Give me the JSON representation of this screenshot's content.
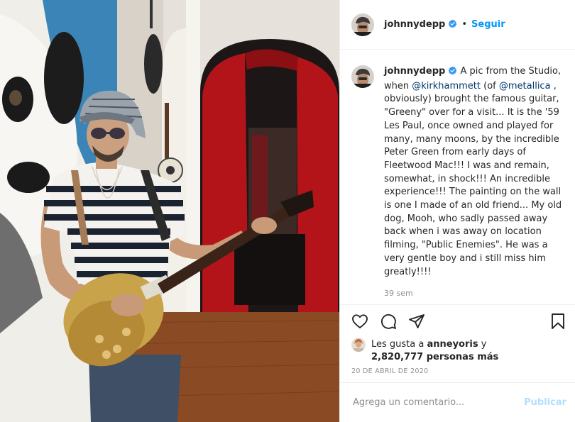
{
  "post": {
    "username": "johnnydepp",
    "follow_label": "Seguir",
    "dot": "•",
    "caption_parts": {
      "p1": "A pic from the Studio, when ",
      "m1": "@kirkhammett",
      "p2": " (of ",
      "m2": "@metallica",
      "p3": " , obviously) brought the famous guitar, \"Greeny\" over for a visit... It is the '59 Les Paul, once owned and played for many, many moons, by the incredible Peter Green from early days of Fleetwood Mac!!! I was and remain, somewhat, in shock!!! An incredible experience!!! The painting on the wall is one I made of an old friend... My old dog, Mooh, who sadly passed away back when i was away on location filming, \"Public Enemies\". He was a very gentle boy and i still miss him greatly!!!!"
    },
    "time_ago": "39 sem",
    "likes": {
      "prefix": "Les gusta a ",
      "user": "anneyoris",
      "mid": " y",
      "count": "2,820,777 personas más"
    },
    "date": "20 DE ABRIL DE 2020",
    "comment_placeholder": "Agrega un comentario...",
    "publish_label": "Publicar",
    "icons": {
      "verified": "verified-badge-icon",
      "like": "heart-icon",
      "comment": "comment-icon",
      "share": "send-icon",
      "save": "bookmark-icon"
    },
    "colors": {
      "link": "#0095f6",
      "mention": "#00376b",
      "muted": "#8e8e8e",
      "publish_disabled": "#b2dffc"
    }
  }
}
